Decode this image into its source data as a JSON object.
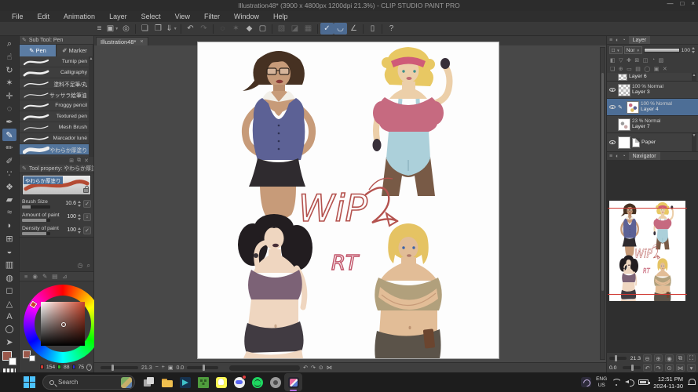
{
  "window": {
    "title": "Illustration48* (3900 x 4800px 1200dpi 21.3%)  - CLIP STUDIO PAINT PRO",
    "minimize": "—",
    "maximize": "□",
    "close": "×"
  },
  "menu": {
    "items": [
      "File",
      "Edit",
      "Animation",
      "Layer",
      "Select",
      "View",
      "Filter",
      "Window",
      "Help"
    ]
  },
  "toolbar": {
    "icons": [
      {
        "name": "main-menu-icon",
        "glyph": "≡"
      },
      {
        "name": "tool-switch-icon",
        "glyph": "▣",
        "caret": true
      },
      {
        "name": "register-material-icon",
        "glyph": "◎"
      },
      {
        "sep": true
      },
      {
        "name": "new-file-icon",
        "glyph": "❏"
      },
      {
        "name": "open-file-icon",
        "glyph": "❒"
      },
      {
        "name": "save-file-icon",
        "glyph": "⇓",
        "caret": true
      },
      {
        "sep": true
      },
      {
        "name": "undo-icon",
        "glyph": "↶"
      },
      {
        "name": "redo-icon",
        "glyph": "↷",
        "disabled": true
      },
      {
        "sep": true
      },
      {
        "name": "processing-icon",
        "glyph": "◌",
        "disabled": true
      },
      {
        "name": "wand-icon",
        "glyph": "✶",
        "disabled": true
      },
      {
        "name": "deselect-icon",
        "glyph": "◆"
      },
      {
        "name": "selection-border-icon",
        "glyph": "▢"
      },
      {
        "sep": true
      },
      {
        "name": "scale-rotate-icon",
        "glyph": "▧",
        "disabled": true
      },
      {
        "name": "transform-icon",
        "glyph": "◪",
        "disabled": true
      },
      {
        "name": "mesh-transform-icon",
        "glyph": "▦",
        "disabled": true
      },
      {
        "sep": true
      },
      {
        "name": "snap-ruler-icon",
        "glyph": "✓",
        "on": true
      },
      {
        "name": "snap-special-ruler-icon",
        "glyph": "◡",
        "on": true
      },
      {
        "name": "snap-grid-icon",
        "glyph": "∠"
      },
      {
        "sep": true
      },
      {
        "name": "tablet-mode-icon",
        "glyph": "▯"
      },
      {
        "sep": true
      },
      {
        "name": "help-icon",
        "glyph": "?"
      }
    ]
  },
  "toolstrip": {
    "tools": [
      {
        "name": "zoom-tool",
        "glyph": "⌕"
      },
      {
        "name": "hand-tool",
        "glyph": "☝"
      },
      {
        "name": "rotate-canvas-tool",
        "glyph": "↻"
      },
      {
        "name": "auto-select-tool",
        "glyph": "✶"
      },
      {
        "name": "move-tool",
        "glyph": "✛"
      },
      {
        "name": "lasso-tool",
        "glyph": "◌"
      },
      {
        "name": "eyedropper-tool",
        "glyph": "✒"
      },
      {
        "name": "pen-tool",
        "glyph": "✎",
        "selected": true
      },
      {
        "name": "pencil-tool",
        "glyph": "✏"
      },
      {
        "name": "brush-tool",
        "glyph": "✐"
      },
      {
        "name": "airbrush-tool",
        "glyph": "∵"
      },
      {
        "name": "decoration-tool",
        "glyph": "❖"
      },
      {
        "name": "eraser-tool",
        "glyph": "▰"
      },
      {
        "name": "blend-tool",
        "glyph": "≈"
      },
      {
        "name": "liquify-tool",
        "glyph": "◗"
      },
      {
        "name": "frame-border-tool",
        "glyph": "⊞"
      },
      {
        "name": "fill-tool",
        "glyph": "◒"
      },
      {
        "name": "gradient-tool",
        "glyph": "▥"
      },
      {
        "name": "balloon-tool",
        "glyph": "◍"
      },
      {
        "name": "figure-tool",
        "glyph": "◻"
      },
      {
        "name": "ruler-tool",
        "glyph": "△"
      },
      {
        "name": "text-tool",
        "glyph": "A"
      },
      {
        "name": "story-tool",
        "glyph": "〇"
      },
      {
        "name": "operation-tool",
        "glyph": "➤"
      }
    ]
  },
  "subtool": {
    "header": "Sub Tool: Pen",
    "tabs": [
      {
        "label": "Pen",
        "glyph": "✎"
      },
      {
        "label": "Marker",
        "glyph": "✐"
      }
    ],
    "selected_index": 8,
    "brushes": [
      {
        "label": "Turnip pen",
        "w": 2.2
      },
      {
        "label": "Calligraphy",
        "w": 2.8
      },
      {
        "label": "塗料不足筆/丸",
        "w": 1.4
      },
      {
        "label": "サッサラ絵筆油彩風",
        "w": 1.0
      },
      {
        "label": "Froggy pencil",
        "w": 2.0
      },
      {
        "label": "Textured pen",
        "w": 2.6
      },
      {
        "label": "Mesh Brush",
        "w": 1.0
      },
      {
        "label": "Marcador luné",
        "w": 1.6
      },
      {
        "label": "やわらか厚塗り",
        "w": 4.6
      }
    ],
    "footer_icons": [
      {
        "name": "add-subtool-icon",
        "glyph": "⊞"
      },
      {
        "name": "duplicate-subtool-icon",
        "glyph": "⧉"
      },
      {
        "name": "delete-subtool-icon",
        "glyph": "✕"
      }
    ]
  },
  "tool_property": {
    "header": "Tool property: やわらか厚塗",
    "preview_label": "やわらか厚塗り",
    "props": [
      {
        "label": "Brush Size",
        "value": "10.6",
        "fill": 30,
        "btn": "✓"
      },
      {
        "label": "Amount of paint",
        "value": "100",
        "fill": 85,
        "btn": "↓"
      },
      {
        "label": "Density of paint",
        "value": "100",
        "fill": 85,
        "btn": "✓"
      }
    ]
  },
  "history_icons": [
    {
      "name": "clock-icon",
      "glyph": "◷"
    },
    {
      "name": "search-small-icon",
      "glyph": "⌕"
    }
  ],
  "color_panel": {
    "header_icons": [
      {
        "name": "color-menu-icon",
        "glyph": "≡"
      },
      {
        "name": "color-wheel-icon",
        "glyph": "◉"
      },
      {
        "name": "color-slider-icon",
        "glyph": "✎"
      },
      {
        "name": "color-set-icon",
        "glyph": "▤"
      },
      {
        "name": "color-history-icon",
        "glyph": "⊿"
      }
    ],
    "r": "154",
    "g": "88",
    "b": "75",
    "fg_hex": "#9a584b"
  },
  "canvas": {
    "tab_label": "Illustration48*",
    "close": "×",
    "zoom": "21.3",
    "rotation": "0.0",
    "status_icons": [
      {
        "name": "zoom-out-icon",
        "glyph": "−"
      },
      {
        "name": "zoom-in-icon",
        "glyph": "+"
      },
      {
        "name": "fit-screen-icon",
        "glyph": "▣"
      }
    ],
    "rotate_icons": [
      {
        "name": "rotate-left-icon",
        "glyph": "↶"
      },
      {
        "name": "rotate-right-icon",
        "glyph": "↷"
      },
      {
        "name": "reset-rotation-icon",
        "glyph": "⊙"
      },
      {
        "name": "flip-horizontal-icon",
        "glyph": "⋈"
      }
    ]
  },
  "layers": {
    "tab_icons": [
      {
        "name": "layer-menu-icon",
        "glyph": "≡"
      },
      {
        "name": "layer-tab2-icon",
        "glyph": "◐"
      },
      {
        "name": "layer-tab3-icon",
        "glyph": "◔"
      }
    ],
    "tab_label": "Layer",
    "blend_box": "□",
    "blend_mode": "Nor",
    "opacity": "100",
    "action_icons_row1": [
      "◧",
      "▽",
      "✚",
      "⊠",
      "◫",
      "◔",
      "▨"
    ],
    "action_icons_row2": [
      "❏",
      "⊕",
      "▭",
      "▤",
      "◯",
      "▣",
      "✕"
    ],
    "items": [
      {
        "name": "Layer 6",
        "info": "",
        "thumb": "checker",
        "eye": false,
        "pencil": false,
        "selected": false,
        "half": true
      },
      {
        "name": "Layer 3",
        "info": "100 % Normal",
        "thumb": "checker",
        "eye": true,
        "pencil": false,
        "selected": false,
        "half": false
      },
      {
        "name": "Layer 4",
        "info": "100 % Normal",
        "thumb": "art",
        "eye": true,
        "pencil": true,
        "selected": true,
        "half": false
      },
      {
        "name": "Layer 7",
        "info": "23 % Normal",
        "thumb": "art2",
        "eye": false,
        "pencil": false,
        "selected": false,
        "half": false
      },
      {
        "name": "Paper",
        "info": "",
        "thumb": "paper",
        "eye": true,
        "pencil": false,
        "selected": false,
        "half": false,
        "paper_icon": true
      }
    ]
  },
  "navigator": {
    "tab_icons": [
      {
        "name": "nav-menu-icon",
        "glyph": "≡"
      },
      {
        "name": "nav-tab2-icon",
        "glyph": "◐"
      },
      {
        "name": "nav-tab3-icon",
        "glyph": "◔"
      }
    ],
    "tab_label": "Navigator",
    "zoom": "21.3",
    "rotation": "0.0",
    "zoom_icons": [
      {
        "name": "nav-zoom-out-icon",
        "glyph": "⊖"
      },
      {
        "name": "nav-zoom-in-icon",
        "glyph": "⊕"
      },
      {
        "name": "nav-fit-icon",
        "glyph": "◉"
      },
      {
        "name": "nav-100-icon",
        "glyph": "⧉"
      },
      {
        "name": "nav-fullscreen-icon",
        "glyph": "⛶"
      }
    ],
    "rotate_icons": [
      {
        "name": "nav-rotate-left-icon",
        "glyph": "↶"
      },
      {
        "name": "nav-rotate-right-icon",
        "glyph": "↷"
      },
      {
        "name": "nav-reset-icon",
        "glyph": "⊙"
      },
      {
        "name": "nav-flip-icon",
        "glyph": "⋈"
      },
      {
        "name": "nav-more-icon",
        "glyph": "▾"
      }
    ]
  },
  "artwork": {
    "wip_text": "WiP",
    "rt_text": "RT"
  },
  "taskbar": {
    "search_placeholder": "Search",
    "apps": [
      {
        "name": "task-view-button",
        "kind": "taskview"
      },
      {
        "name": "file-explorer-button",
        "kind": "folder"
      },
      {
        "name": "edge-app-button",
        "kind": "bluedoc"
      },
      {
        "name": "minecraft-app-button",
        "kind": "minecraft"
      },
      {
        "name": "snapchat-app-button",
        "kind": "snapchat"
      },
      {
        "name": "discord-app-button",
        "kind": "discord",
        "badge": true
      },
      {
        "name": "spotify-app-button",
        "kind": "spotify"
      },
      {
        "name": "media-app-button",
        "kind": "greycam"
      },
      {
        "name": "clip-studio-paint-button",
        "kind": "csp",
        "active": true
      }
    ],
    "lang1": "ENG",
    "lang2": "US",
    "time": "12:51 PM",
    "date": "2024-11-30"
  }
}
